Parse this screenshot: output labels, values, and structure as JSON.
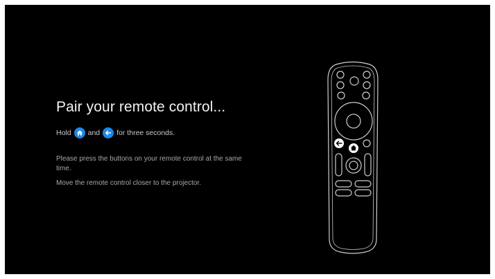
{
  "pairing": {
    "title": "Pair your remote control...",
    "hold_prefix": "Hold",
    "hold_and": "and",
    "hold_suffix": "for three seconds.",
    "instruction_press": "Please press the buttons on your remote control at the same time.",
    "instruction_move": "Move the remote control closer to the projector."
  },
  "icons": {
    "home_button": "home-icon",
    "back_button": "arrow-left-icon"
  },
  "colors": {
    "background": "#000000",
    "accent": "#1e88e5",
    "title_text": "#f2f2f2",
    "body_text": "#a8a8a8"
  }
}
